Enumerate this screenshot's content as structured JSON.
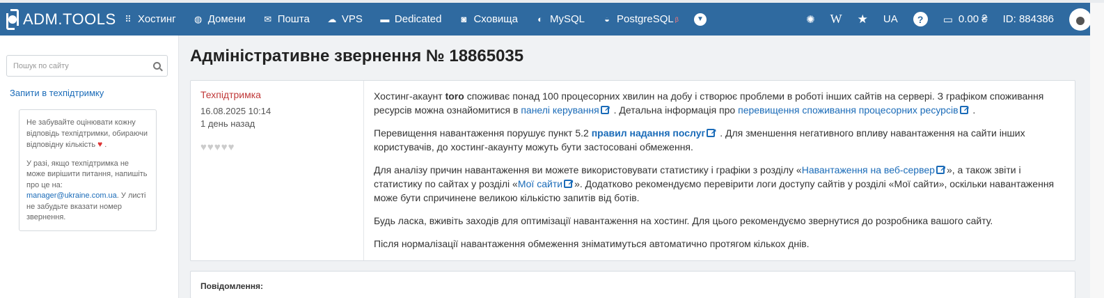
{
  "brand": {
    "name": "ADM.TOOLS"
  },
  "nav": {
    "items": [
      {
        "label": "Хостинг",
        "icon": "sitemap-icon"
      },
      {
        "label": "Домени",
        "icon": "globe-icon"
      },
      {
        "label": "Пошта",
        "icon": "envelope-icon"
      },
      {
        "label": "VPS",
        "icon": "cloud-icon"
      },
      {
        "label": "Dedicated",
        "icon": "server-icon"
      },
      {
        "label": "Сховища",
        "icon": "storage-icon"
      },
      {
        "label": "MySQL",
        "icon": "dolphin-icon"
      },
      {
        "label": "PostgreSQL",
        "icon": "elephant-icon",
        "badge": "β"
      }
    ],
    "right": {
      "lang": "UA",
      "balance": "0.00 ₴",
      "account_id": "ID: 884386"
    }
  },
  "sidebar": {
    "search_placeholder": "Пошук по сайту",
    "link": "Запити в техпідтримку",
    "note_p1_a": "Не забувайте оцінювати кожну відповідь техпідтримки, обираючи відповідну кількість",
    "note_p1_b": ".",
    "note_p2_a": "У разі, якщо техпідтримка не може вирішити питання, напишіть про це на:",
    "note_email": "manager@ukraine.com.ua",
    "note_p2_b": ". У листі не забудьте вказати номер звернення."
  },
  "page": {
    "title": "Адміністративне звернення № 18865035"
  },
  "message": {
    "author": "Техпідтримка",
    "date": "16.08.2025 10:14",
    "ago": "1 день назад",
    "rating_hearts": "♥♥♥♥♥",
    "p1": {
      "a": "Хостинг-акаунт",
      "account": "toro",
      "b": "споживає понад 100 процесорних хвилин на добу і створює проблеми в роботі інших сайтів на сервері. З графіком споживання ресурсів можна ознайомитися в",
      "link1": "панелі керування",
      "c": ". Детальна інформація про",
      "link2": "перевищення споживання процесорних ресурсів",
      "d": "."
    },
    "p2": {
      "a": "Перевищення навантаження порушує пункт 5.2",
      "link": "правил надання послуг",
      "b": ". Для зменшення негативного впливу навантаження на сайти інших користувачів, до хостинг-акаунту можуть бути застосовані обмеження."
    },
    "p3": {
      "a": "Для аналізу причин навантаження ви можете використовувати статистику і графіки з розділу «",
      "link1": "Навантаження на веб-сервер",
      "b": "», а також звіти і статистику по сайтах у розділі «",
      "link2": "Мої сайти",
      "c": "». Додатково рекомендуємо перевірити логи доступу сайтів у розділі «Мої сайти», оскільки навантаження може бути спричинене великою кількістю запитів від ботів."
    },
    "p4": "Будь ласка, вживіть заходів для оптимізації навантаження на хостинг. Для цього рекомендуємо звернутися до розробника вашого сайту.",
    "p5": "Після нормалізації навантаження обмеження зніматимуться автоматично протягом кількох днів."
  },
  "reply": {
    "label": "Повідомлення:"
  }
}
